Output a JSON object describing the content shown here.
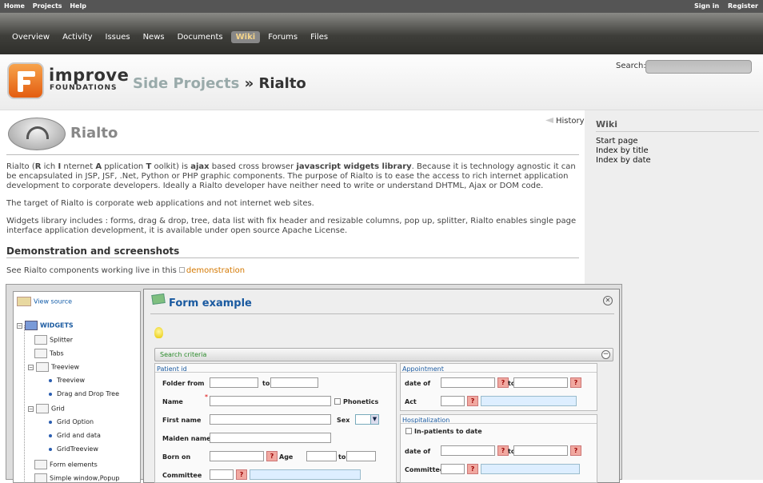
{
  "top_menu": {
    "home": "Home",
    "projects": "Projects",
    "help": "Help",
    "sign_in": "Sign in",
    "register": "Register"
  },
  "main_menu": [
    {
      "label": "Overview",
      "selected": false
    },
    {
      "label": "Activity",
      "selected": false
    },
    {
      "label": "Issues",
      "selected": false
    },
    {
      "label": "News",
      "selected": false
    },
    {
      "label": "Documents",
      "selected": false
    },
    {
      "label": "Wiki",
      "selected": true
    },
    {
      "label": "Forums",
      "selected": false
    },
    {
      "label": "Files",
      "selected": false
    }
  ],
  "header": {
    "brand_main": "improve",
    "brand_sub": "FOUNDATIONS",
    "parent_project": "Side Projects",
    "separator": " » ",
    "project": "Rialto",
    "search_label": "Search:",
    "search_value": ""
  },
  "sidebar": {
    "title": "Wiki",
    "links": [
      "Start page",
      "Index by title",
      "Index by date"
    ]
  },
  "wiki": {
    "logo_title": "Rialto",
    "history_link": "History",
    "para1_parts": [
      "Rialto (",
      "R",
      " ich ",
      "I",
      " nternet ",
      "A",
      " pplication ",
      "T",
      " oolkit) is ",
      "ajax",
      " based cross browser ",
      "javascript widgets library",
      ". Because it is technology agnostic it can be encapsulated in JSP, JSF, .Net, Python or PHP graphic components. The purpose of Rialto is to ease the access to rich internet application development to corporate developers. Ideally a Rialto developer have neither need to write or understand DHTML, Ajax or DOM code."
    ],
    "para2": "The target of Rialto is corporate web applications and not internet web sites.",
    "para3": "Widgets library includes : forms, drag & drop, tree, data list with fix header and resizable columns, pop up, splitter, Rialto enables single page interface application development, it is available under open source Apache License.",
    "section_heading": "Demonstration and screenshots",
    "demo_text": "See Rialto components working live in this",
    "demo_link": "demonstration"
  },
  "screenshot": {
    "view_source": "View source",
    "tree": [
      {
        "label": "WIDGETS",
        "kind": "root"
      },
      {
        "label": "Splitter",
        "kind": "icon"
      },
      {
        "label": "Tabs",
        "kind": "icon"
      },
      {
        "label": "Treeview",
        "kind": "folder"
      },
      {
        "label": "Treeview",
        "kind": "leaf"
      },
      {
        "label": "Drag and Drop Tree",
        "kind": "leaf"
      },
      {
        "label": "Grid",
        "kind": "folder"
      },
      {
        "label": "Grid Option",
        "kind": "leaf"
      },
      {
        "label": "Grid and data",
        "kind": "leaf"
      },
      {
        "label": "GridTreeview",
        "kind": "leaf"
      },
      {
        "label": "Form elements",
        "kind": "icon"
      },
      {
        "label": "Simple window,Popup",
        "kind": "icon"
      }
    ],
    "form_title": "Form example",
    "search_criteria": "Search criteria",
    "patient_group": "Patient id",
    "appointment_group": "Appointment",
    "hospitalization_group": "Hospitalization",
    "labels": {
      "folder_from": "Folder from",
      "to": "to",
      "name": "Name",
      "phonetics": "Phonetics",
      "first_name": "First name",
      "sex": "Sex",
      "maiden_name": "Maiden name",
      "born_on": "Born on",
      "age": "Age",
      "committee": "Committee",
      "date_of": "date of",
      "act": "Act",
      "in_patients": "In-patients to date"
    }
  }
}
